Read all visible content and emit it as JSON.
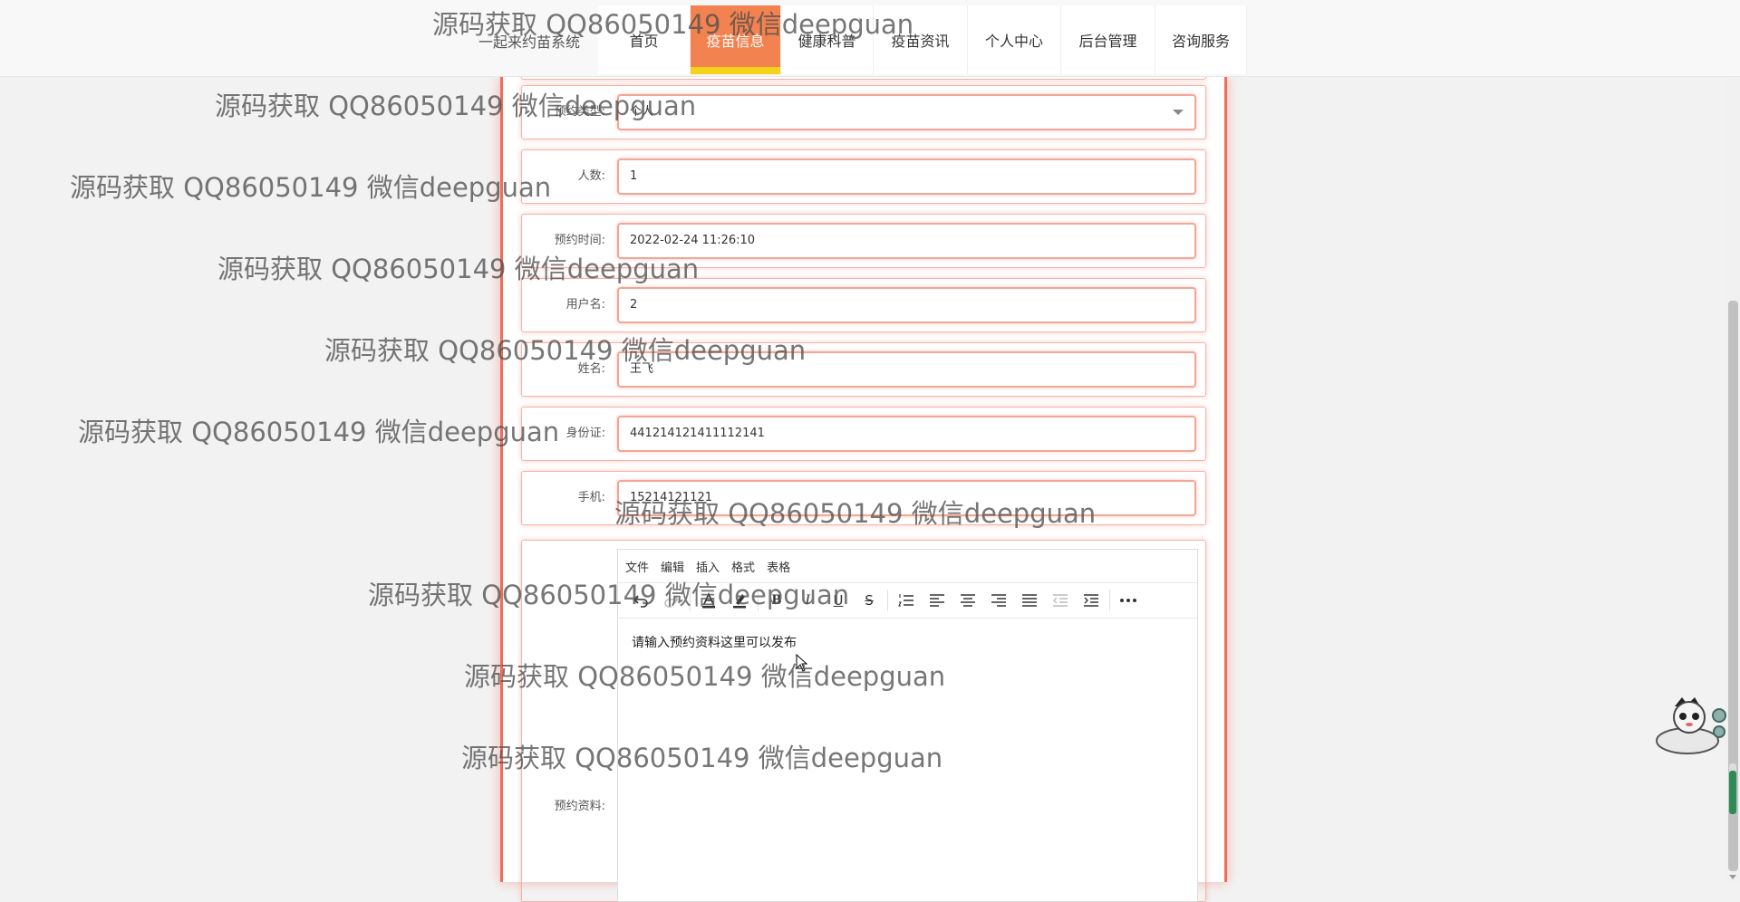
{
  "header": {
    "site_title": "一起来约苗系统",
    "nav": [
      {
        "label": "首页",
        "active": false
      },
      {
        "label": "疫苗信息",
        "active": true
      },
      {
        "label": "健康科普",
        "active": false
      },
      {
        "label": "疫苗资讯",
        "active": false
      },
      {
        "label": "个人中心",
        "active": false
      },
      {
        "label": "后台管理",
        "active": false
      },
      {
        "label": "咨询服务",
        "active": false
      }
    ]
  },
  "form": {
    "type": {
      "label": "预约类型:",
      "value": "个人"
    },
    "count": {
      "label": "人数:",
      "value": "1"
    },
    "time": {
      "label": "预约时间:",
      "value": "2022-02-24 11:26:10"
    },
    "username": {
      "label": "用户名:",
      "value": "2"
    },
    "name": {
      "label": "姓名:",
      "value": "王飞"
    },
    "id_card": {
      "label": "身份证:",
      "value": "441214121411112141"
    },
    "phone": {
      "label": "手机:",
      "value": "15214121121"
    },
    "material": {
      "label": "预约资料:"
    }
  },
  "editor": {
    "menus": [
      "文件",
      "编辑",
      "插入",
      "格式",
      "表格"
    ],
    "tools": [
      "undo-icon",
      "redo-icon",
      "font-color-icon",
      "highlight-icon",
      "bold-icon",
      "italic-icon",
      "underline-icon",
      "strikethrough-icon",
      "numbered-list-icon",
      "align-left-icon",
      "align-center-icon",
      "align-right-icon",
      "align-justify-icon",
      "outdent-icon",
      "indent-icon",
      "more-icon"
    ],
    "content": "请输入预约资料这里可以发布"
  },
  "watermark": "源码获取 QQ86050149 微信deepguan",
  "colors": {
    "accent": "#f2824f",
    "active_underline": "#f7d21c",
    "card_border": "#f26d57"
  },
  "side_gauge": {
    "level": 0.85
  }
}
